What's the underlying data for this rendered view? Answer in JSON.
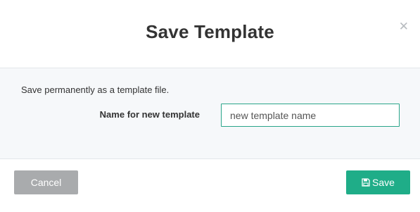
{
  "dialog": {
    "title": "Save Template",
    "close_icon": "close-icon"
  },
  "body": {
    "description": "Save permanently as a template file.",
    "field_label": "Name for new template",
    "name_input": {
      "value": "",
      "placeholder": "new template name"
    }
  },
  "footer": {
    "cancel_label": "Cancel",
    "save_label": "Save",
    "save_icon": "floppy-disk-icon"
  },
  "colors": {
    "accent": "#1fad88",
    "input_border": "#2aa58a",
    "cancel": "#a9abad",
    "body_background": "#f6f8fa"
  }
}
